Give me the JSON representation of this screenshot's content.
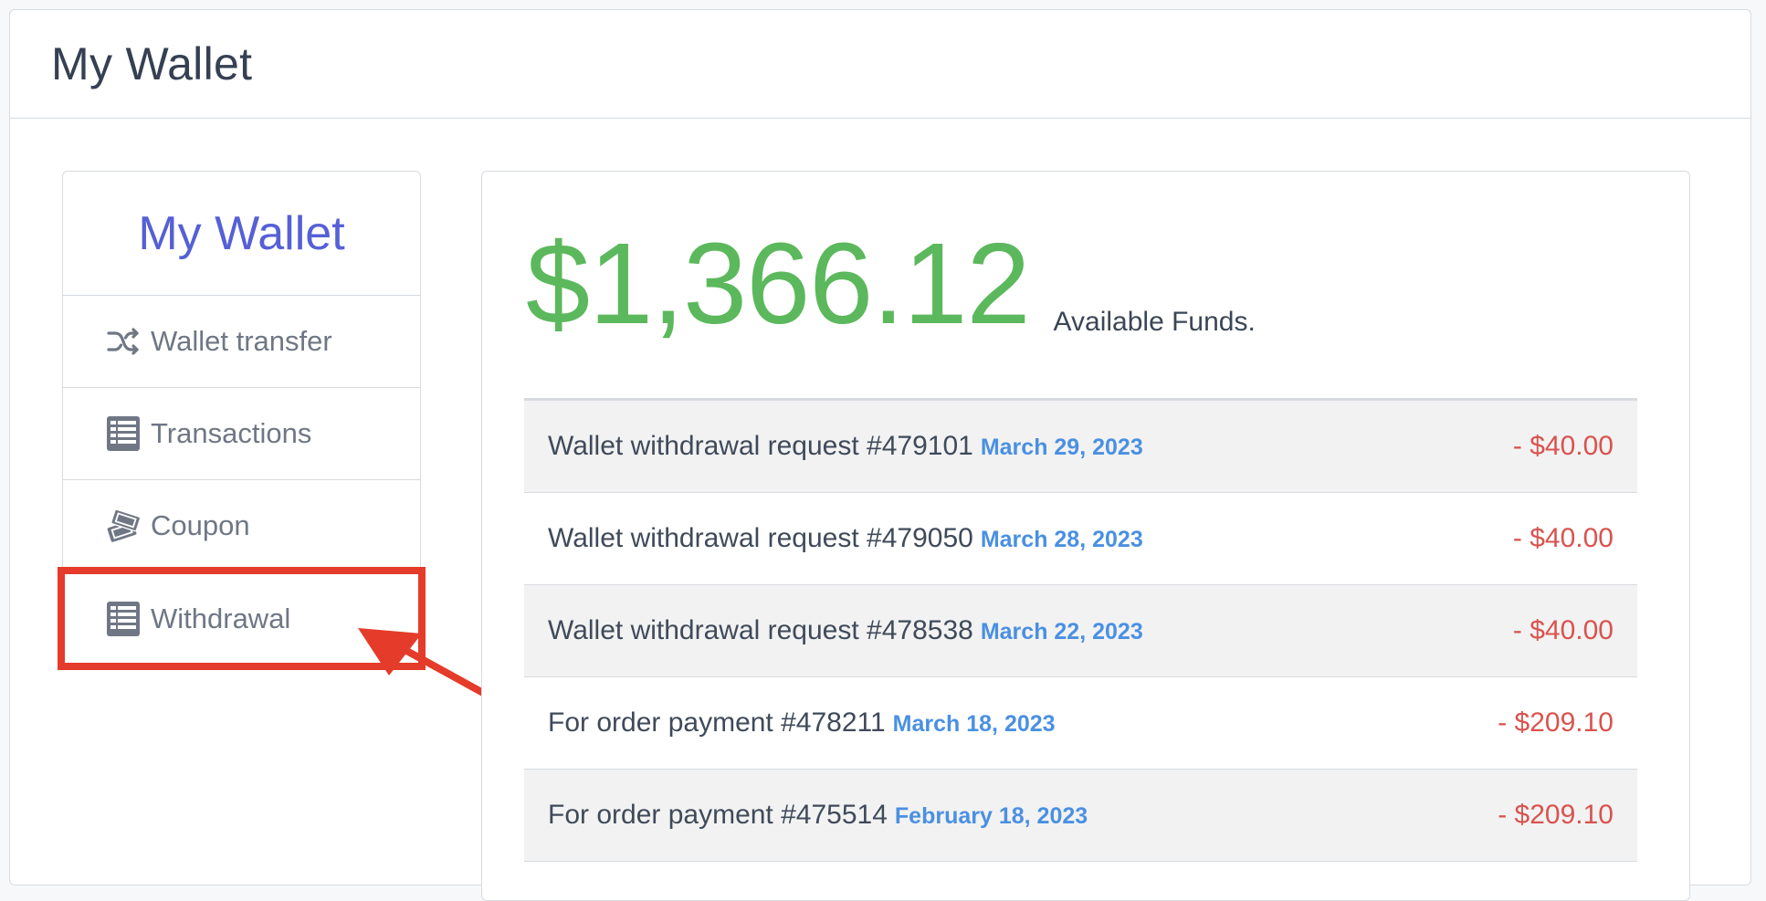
{
  "page": {
    "title": "My Wallet"
  },
  "sidebar": {
    "title": "My Wallet",
    "items": [
      {
        "label": "Wallet transfer",
        "icon": "shuffle-icon"
      },
      {
        "label": "Transactions",
        "icon": "list-icon"
      },
      {
        "label": "Coupon",
        "icon": "ticket-icon"
      },
      {
        "label": "Withdrawal",
        "icon": "list-icon"
      }
    ]
  },
  "balance": {
    "amount": "$1,366.12",
    "label": "Available Funds."
  },
  "transactions": [
    {
      "description": "Wallet withdrawal request #479101",
      "date": "March 29, 2023",
      "amount": "- $40.00"
    },
    {
      "description": "Wallet withdrawal request #479050",
      "date": "March 28, 2023",
      "amount": "- $40.00"
    },
    {
      "description": "Wallet withdrawal request #478538",
      "date": "March 22, 2023",
      "amount": "- $40.00"
    },
    {
      "description": "For order payment #478211",
      "date": "March 18, 2023",
      "amount": "- $209.10"
    },
    {
      "description": "For order payment #475514",
      "date": "February 18, 2023",
      "amount": "- $209.10"
    }
  ],
  "colors": {
    "accent": "#5560d6",
    "balance": "#5cb85c",
    "date": "#4a90e2",
    "debit": "#d9534f",
    "highlight": "#e53b2a"
  }
}
